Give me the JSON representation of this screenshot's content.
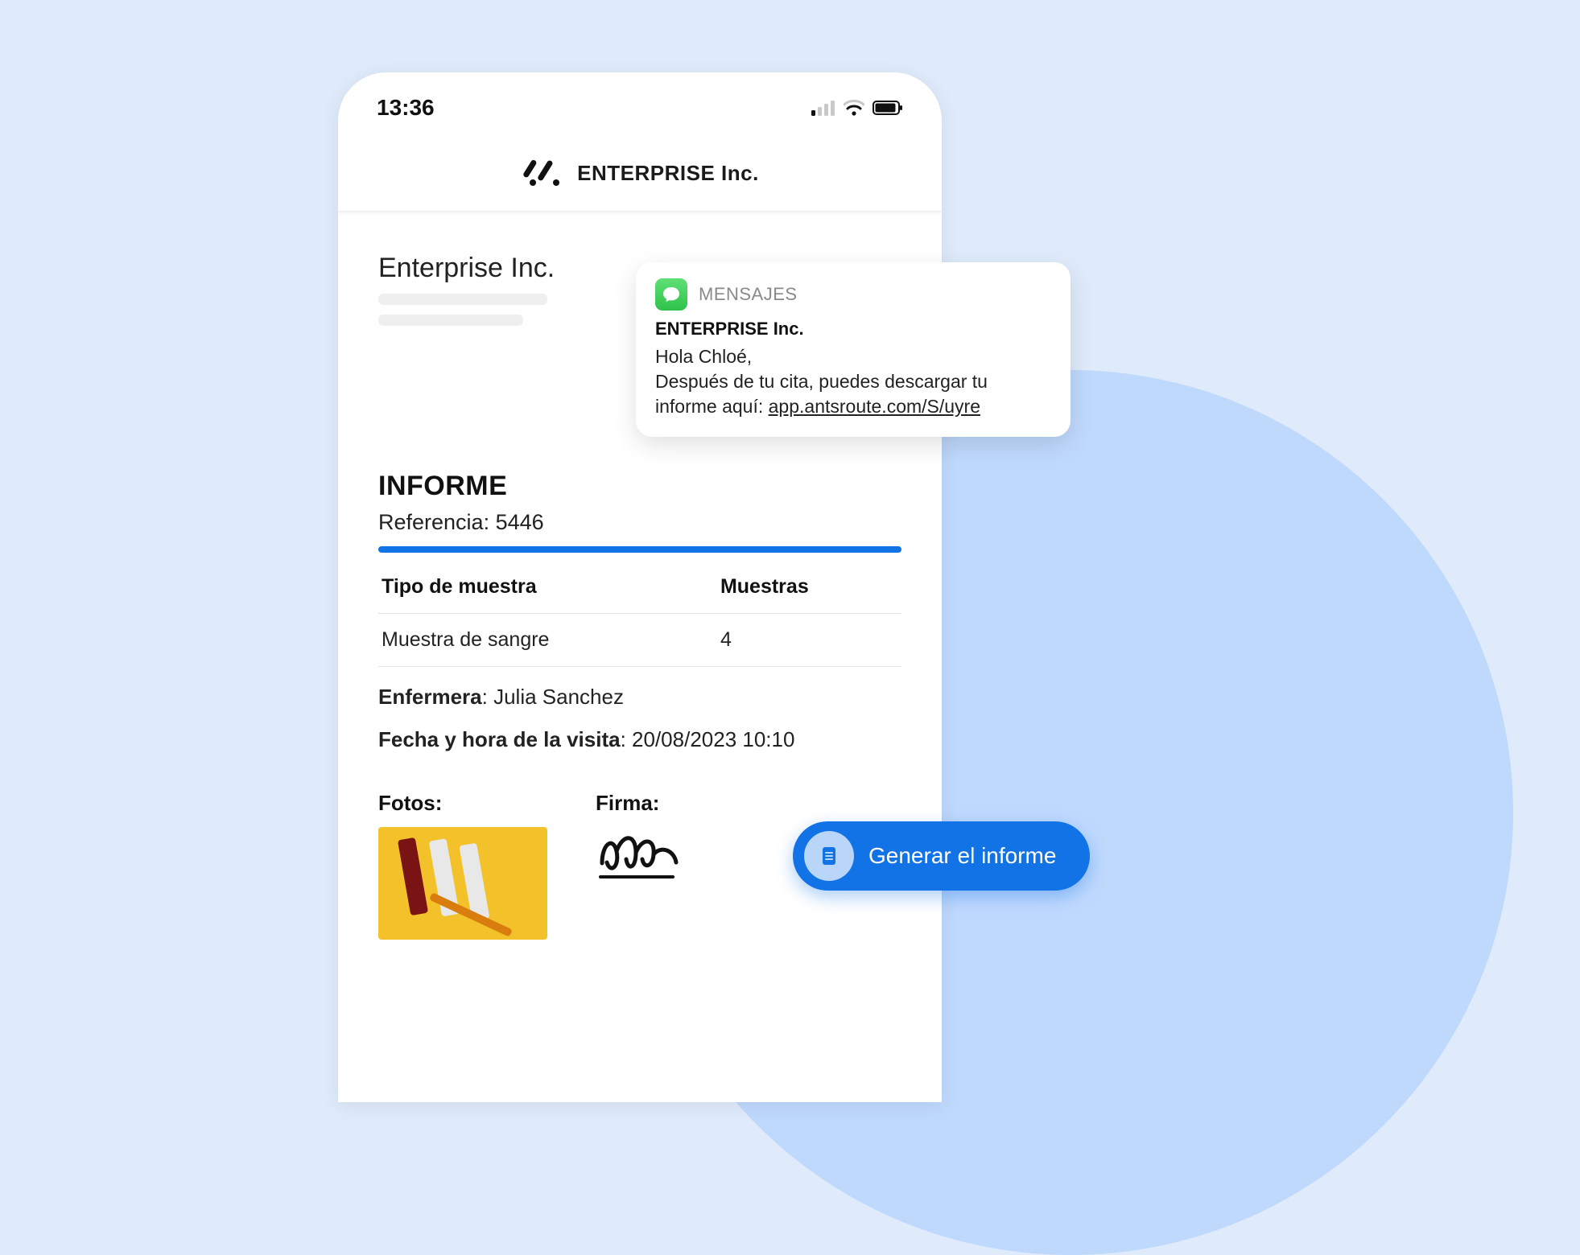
{
  "statusbar": {
    "time": "13:36"
  },
  "header": {
    "brand": "ENTERPRISE Inc."
  },
  "company": {
    "name": "Enterprise Inc."
  },
  "report": {
    "title": "INFORME",
    "ref_label": "Referencia:",
    "ref_value": "5446",
    "col_type": "Tipo de muestra",
    "col_qty": "Muestras",
    "row_type": "Muestra de sangre",
    "row_qty": "4",
    "nurse_label": "Enfermera",
    "nurse_name": "Julia Sanchez",
    "visit_label": "Fecha y hora de la visita",
    "visit_value": "20/08/2023 10:10",
    "photos_label": "Fotos:",
    "signature_label": "Firma:"
  },
  "notification": {
    "app": "MENSAJES",
    "sender": "ENTERPRISE Inc.",
    "greeting": "Hola Chloé,",
    "body": "Después de tu cita, puedes descargar tu informe aquí: ",
    "link": "app.antsroute.com/S/uyre"
  },
  "cta": {
    "label": "Generar el informe"
  }
}
